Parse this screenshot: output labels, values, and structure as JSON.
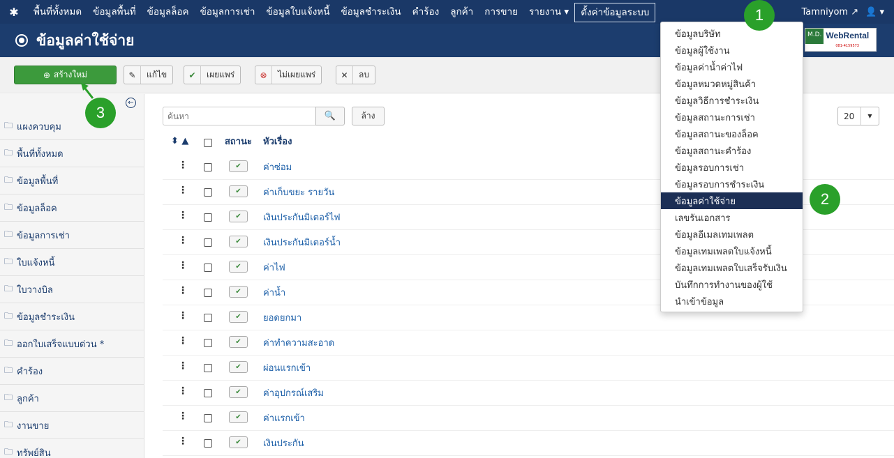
{
  "navbar": {
    "brand_icon": "joomla-logo-icon",
    "menu": [
      "พื้นที่ทั้งหมด",
      "ข้อมูลพื้นที่",
      "ข้อมูลล็อค",
      "ข้อมูลการเช่า",
      "ข้อมูลใบแจ้งหนี้",
      "ข้อมูลชำระเงิน",
      "คำร้อง",
      "ลูกค้า",
      "การขาย",
      "รายงาน ▾",
      "ตั้งค่าข้อมูลระบบ"
    ],
    "user": "Tamniyom",
    "user_icon": "external-link-icon"
  },
  "header": {
    "title": "ข้อมูลค่าใช้จ่าย"
  },
  "logo": {
    "md": "M.D.",
    "name": "WebRental",
    "phone": "081-4159573"
  },
  "toolbar": {
    "new": "สร้างใหม่",
    "edit": "แก้ไข",
    "publish": "เผยแพร่",
    "unpublish": "ไม่เผยแพร่",
    "delete": "ลบ"
  },
  "sidebar": {
    "items": [
      "แผงควบคุม",
      "พื้นที่ทั้งหมด",
      "ข้อมูลพื้นที่",
      "ข้อมูลล็อค",
      "ข้อมูลการเช่า",
      "ใบแจ้งหนี้",
      "ใบวางบิล",
      "ข้อมูลชำระเงิน",
      "ออกใบเสร็จแบบด่วน *",
      "คำร้อง",
      "ลูกค้า",
      "งานขาย",
      "ทรัพย์สิน"
    ]
  },
  "search": {
    "placeholder": "ค้นหา",
    "clear": "ล้าง"
  },
  "limit": "20",
  "table": {
    "headers": {
      "sort": "⬍ ▲",
      "status": "สถานะ",
      "title": "หัวเรื่อง"
    },
    "rows": [
      "ค่าซ่อม",
      "ค่าเก็บขยะ รายวัน",
      "เงินประกันมิเตอร์ไฟ",
      "เงินประกันมิเตอร์น้ำ",
      "ค่าไฟ",
      "ค่าน้ำ",
      "ยอดยกมา",
      "ค่าทำความสะอาด",
      "ผ่อนแรกเข้า",
      "ค่าอุปกรณ์เสริม",
      "ค่าแรกเข้า",
      "เงินประกัน"
    ]
  },
  "dropdown": {
    "items": [
      "ข้อมูลบริษัท",
      "ข้อมูลผู้ใช้งาน",
      "ข้อมูลค่าน้ำค่าไฟ",
      "ข้อมูลหมวดหมู่สินค้า",
      "ข้อมูลวิธีการชำระเงิน",
      "ข้อมูลสถานะการเช่า",
      "ข้อมูลสถานะของล็อค",
      "ข้อมูลสถานะคำร้อง",
      "ข้อมูลรอบการเช่า",
      "ข้อมูลรอบการชำระเงิน",
      "ข้อมูลค่าใช้จ่าย",
      "เลขรันเอกสาร",
      "ข้อมูลอีเมลเทมเพลต",
      "ข้อมูลเทมเพลตใบแจ้งหนี้",
      "ข้อมูลเทมเพลตใบเสร็จรับเงิน",
      "บันทึกการทำงานของผู้ใช้",
      "นำเข้าข้อมูล"
    ],
    "active_index": 10
  },
  "callouts": [
    "1",
    "2",
    "3"
  ],
  "colors": {
    "navbar": "#1a3867",
    "header": "#1c3d6e",
    "new_button": "#3c9a3c",
    "callout": "#2aa02a",
    "active_item": "#1c2f55"
  }
}
